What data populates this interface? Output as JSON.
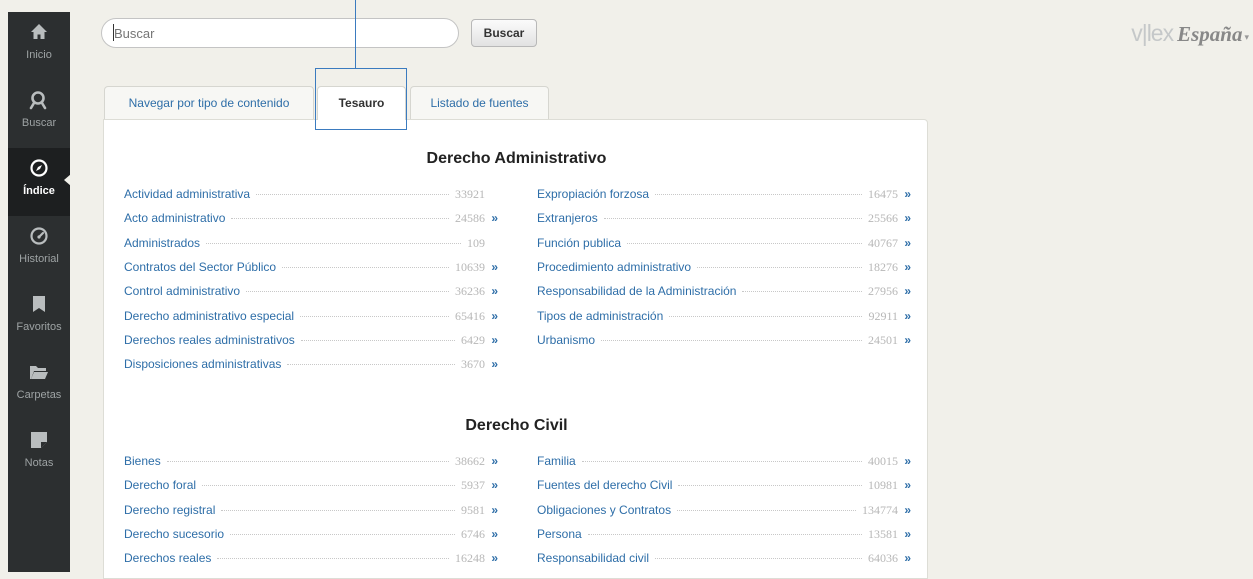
{
  "sidebar": {
    "items": [
      {
        "label": "Inicio",
        "icon": "home-icon"
      },
      {
        "label": "Buscar",
        "icon": "search-icon"
      },
      {
        "label": "Índice",
        "icon": "compass-icon",
        "active": true
      },
      {
        "label": "Historial",
        "icon": "history-gauge-icon"
      },
      {
        "label": "Favoritos",
        "icon": "bookmark-icon"
      },
      {
        "label": "Carpetas",
        "icon": "folder-icon"
      },
      {
        "label": "Notas",
        "icon": "note-icon"
      }
    ]
  },
  "search": {
    "placeholder": "Buscar",
    "button_label": "Buscar"
  },
  "brand": {
    "logo": "v|lex",
    "country": "España",
    "caret": "▾"
  },
  "tabs": [
    {
      "label": "Navegar por tipo de contenido"
    },
    {
      "label": "Tesauro",
      "active": true
    },
    {
      "label": "Listado de fuentes"
    }
  ],
  "more_glyph": "»",
  "sections": [
    {
      "title": "Derecho Administrativo",
      "left": [
        {
          "name": "Actividad administrativa",
          "count": "33921",
          "more": false
        },
        {
          "name": "Acto administrativo",
          "count": "24586",
          "more": true
        },
        {
          "name": "Administrados",
          "count": "109",
          "more": false
        },
        {
          "name": "Contratos del Sector Público",
          "count": "10639",
          "more": true
        },
        {
          "name": "Control administrativo",
          "count": "36236",
          "more": true
        },
        {
          "name": "Derecho administrativo especial",
          "count": "65416",
          "more": true
        },
        {
          "name": "Derechos reales administrativos",
          "count": "6429",
          "more": true
        },
        {
          "name": "Disposiciones administrativas",
          "count": "3670",
          "more": true
        }
      ],
      "right": [
        {
          "name": "Expropiación forzosa",
          "count": "16475",
          "more": true
        },
        {
          "name": "Extranjeros",
          "count": "25566",
          "more": true
        },
        {
          "name": "Función publica",
          "count": "40767",
          "more": true
        },
        {
          "name": "Procedimiento administrativo",
          "count": "18276",
          "more": true
        },
        {
          "name": "Responsabilidad de la Administración",
          "count": "27956",
          "more": true
        },
        {
          "name": "Tipos de administración",
          "count": "92911",
          "more": true
        },
        {
          "name": "Urbanismo",
          "count": "24501",
          "more": true
        }
      ]
    },
    {
      "title": "Derecho Civil",
      "left": [
        {
          "name": "Bienes",
          "count": "38662",
          "more": true
        },
        {
          "name": "Derecho foral",
          "count": "5937",
          "more": true
        },
        {
          "name": "Derecho registral",
          "count": "9581",
          "more": true
        },
        {
          "name": "Derecho sucesorio",
          "count": "6746",
          "more": true
        },
        {
          "name": "Derechos reales",
          "count": "16248",
          "more": true
        }
      ],
      "right": [
        {
          "name": "Familia",
          "count": "40015",
          "more": true
        },
        {
          "name": "Fuentes del derecho Civil",
          "count": "10981",
          "more": true
        },
        {
          "name": "Obligaciones y Contratos",
          "count": "134774",
          "more": true
        },
        {
          "name": "Persona",
          "count": "13581",
          "more": true
        },
        {
          "name": "Responsabilidad civil",
          "count": "64036",
          "more": true
        }
      ]
    }
  ],
  "colors": {
    "link": "#2e6ea8",
    "sidebar_bg": "#2c2f30",
    "highlight": "#3b7bbf"
  }
}
